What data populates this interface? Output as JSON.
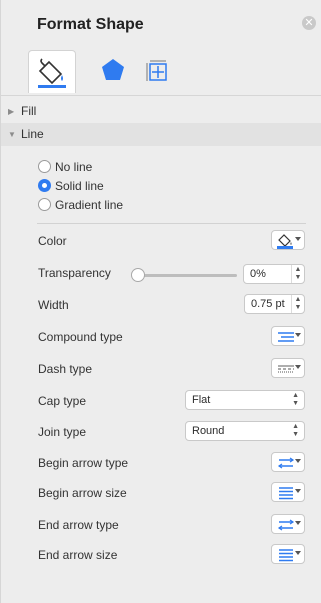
{
  "panel": {
    "title": "Format Shape",
    "close_icon": "close-icon",
    "tabs": [
      {
        "name": "fill-and-line",
        "icon": "paint-bucket-icon",
        "active": true
      },
      {
        "name": "effects",
        "icon": "pentagon-icon",
        "active": false
      },
      {
        "name": "size-and-properties",
        "icon": "size-properties-icon",
        "active": false
      }
    ]
  },
  "sections": {
    "fill": {
      "label": "Fill",
      "expanded": false
    },
    "line": {
      "label": "Line",
      "expanded": true
    }
  },
  "line": {
    "options": [
      {
        "label": "No line",
        "selected": false
      },
      {
        "label": "Solid line",
        "selected": true
      },
      {
        "label": "Gradient line",
        "selected": false
      }
    ],
    "color": {
      "label": "Color",
      "swatch": "#2f7bf0",
      "icon": "paint-bucket-icon"
    },
    "transparency": {
      "label": "Transparency",
      "value": "0%",
      "slider_fraction": 0.0
    },
    "width": {
      "label": "Width",
      "value": "0.75 pt"
    },
    "compound_type": {
      "label": "Compound type",
      "icon": "compound-lines-icon"
    },
    "dash_type": {
      "label": "Dash type",
      "icon": "dash-lines-icon"
    },
    "cap_type": {
      "label": "Cap type",
      "value": "Flat"
    },
    "join_type": {
      "label": "Join type",
      "value": "Round"
    },
    "begin_arrow_type": {
      "label": "Begin arrow type",
      "icon": "arrow-type-icon"
    },
    "begin_arrow_size": {
      "label": "Begin arrow size",
      "icon": "arrow-size-icon"
    },
    "end_arrow_type": {
      "label": "End arrow type",
      "icon": "arrow-type-icon"
    },
    "end_arrow_size": {
      "label": "End arrow size",
      "icon": "arrow-size-icon"
    }
  },
  "colors": {
    "accent": "#2f7bf0",
    "panel_bg": "#ededed"
  }
}
